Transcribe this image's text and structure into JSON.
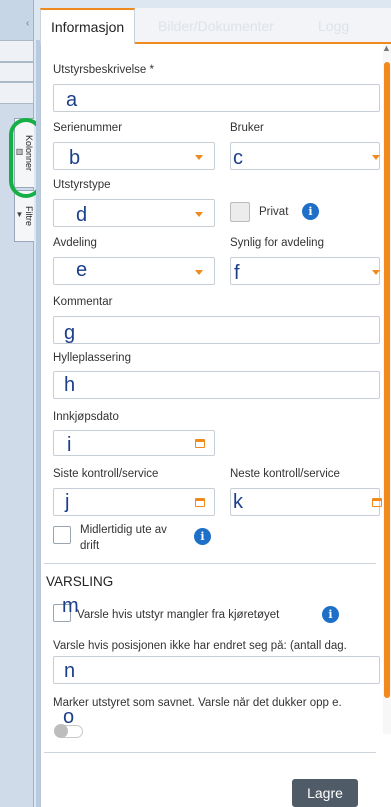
{
  "sidebar": {
    "tabs": [
      {
        "label": "Kolonner",
        "icon": "columns-icon"
      },
      {
        "label": "Filtre",
        "icon": "filter-icon"
      }
    ]
  },
  "tabs": [
    {
      "label": "Informasjon",
      "active": true
    },
    {
      "label": "Bilder/Dokumenter",
      "active": false
    },
    {
      "label": "Logg",
      "active": false
    }
  ],
  "form": {
    "description": {
      "label": "Utstyrsbeskrivelse *",
      "value": "a"
    },
    "serial": {
      "label": "Serienummer",
      "value": "b"
    },
    "user": {
      "label": "Bruker",
      "value": "c"
    },
    "type": {
      "label": "Utstyrstype",
      "value": "d"
    },
    "private": {
      "label": "Privat"
    },
    "department": {
      "label": "Avdeling",
      "value": "e"
    },
    "visible_for": {
      "label": "Synlig for avdeling",
      "value": "f"
    },
    "comment": {
      "label": "Kommentar",
      "value": "g"
    },
    "shelf": {
      "label": "Hylleplassering",
      "value": "h"
    },
    "purchase_date": {
      "label": "Innkjøpsdato",
      "value": "i"
    },
    "last_service": {
      "label": "Siste kontroll/service",
      "value": "j"
    },
    "next_service": {
      "label": "Neste kontroll/service",
      "value": "k"
    },
    "out_of_service": {
      "label_line1": "Midlertidig ute av",
      "label_line2": "drift"
    }
  },
  "alerts": {
    "section_title": "VARSLING",
    "missing_from_vehicle": {
      "marker": "m",
      "label": "Varsle hvis utstyr mangler fra kjøretøyet"
    },
    "position_unchanged": {
      "label": "Varsle hvis posisjonen ikke har endret seg på: (antall dag.",
      "value": "n"
    },
    "mark_missing": {
      "label": "Marker utstyret som savnet. Varsle når det dukker opp e.",
      "marker": "o",
      "enabled": false
    }
  },
  "actions": {
    "save_label": "Lagre"
  },
  "colors": {
    "accent": "#f08a1c",
    "info": "#1e6fc8",
    "highlight_ring": "#15b045",
    "annotation_text": "#1c3f8a"
  }
}
